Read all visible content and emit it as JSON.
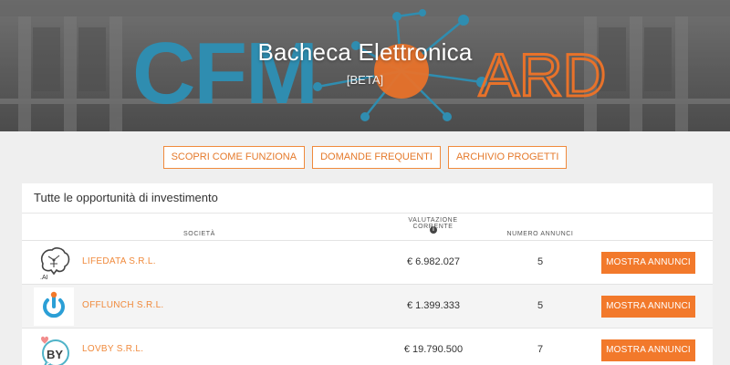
{
  "hero": {
    "logo_left": "CFM",
    "logo_right": "ARD",
    "title": "Bacheca Elettronica",
    "subtitle": "[BETA]"
  },
  "nav": {
    "buttons": [
      "SCOPRI COME FUNZIONA",
      "DOMANDE FREQUENTI",
      "ARCHIVIO PROGETTI"
    ]
  },
  "table": {
    "title": "Tutte le opportunità di investimento",
    "headers": {
      "company": "SOCIETÀ",
      "valuation": "VALUTAZIONE CORRENTE",
      "count": "NUMERO ANNUNCI"
    },
    "rows": [
      {
        "logo": "brain-ai-icon",
        "name": "LIFEDATA S.R.L.",
        "valuation": "€ 6.982.027",
        "count": "5",
        "button": "MOSTRA ANNUNCI"
      },
      {
        "logo": "power-icon",
        "name": "OFFLUNCH S.R.L.",
        "valuation": "€ 1.399.333",
        "count": "5",
        "button": "MOSTRA ANNUNCI"
      },
      {
        "logo": "by-speech-bubble-icon",
        "name": "LOVBY S.R.L.",
        "valuation": "€ 19.790.500",
        "count": "7",
        "button": "MOSTRA ANNUNCI"
      }
    ]
  },
  "colors": {
    "accent": "#f2792b",
    "logo_teal": "#2f8db0",
    "logo_orange": "#e8722a"
  }
}
